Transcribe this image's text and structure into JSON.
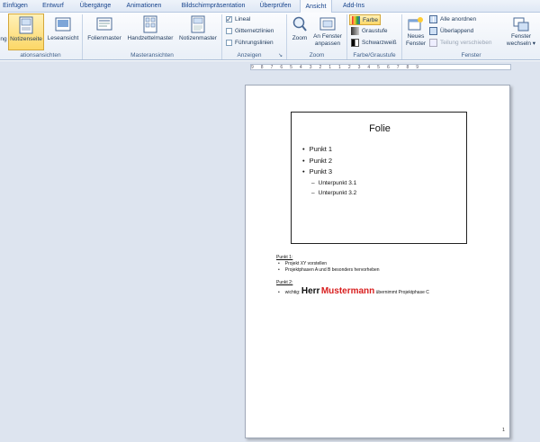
{
  "tabs": [
    "Einfügen",
    "Entwurf",
    "Übergänge",
    "Animationen",
    "Bildschirmpräsentation",
    "Überprüfen",
    "Ansicht",
    "Add-Ins"
  ],
  "ribbon": {
    "groups": {
      "presentation_views": "ationsansichten",
      "master_views": "Masteransichten",
      "show": "Anzeigen",
      "zoom": "Zoom",
      "color": "Farbe/Graustufe",
      "window": "Fenster"
    },
    "buttons": {
      "partial": "ng",
      "notes_page": "Notizenseite",
      "reading_view": "Leseansicht",
      "slide_master": "Folienmaster",
      "handout_master": "Handzettelmaster",
      "notes_master": "Notizenmaster",
      "zoom": "Zoom",
      "fit_window_1": "An Fenster",
      "fit_window_2": "anpassen",
      "new_window_1": "Neues",
      "new_window_2": "Fenster",
      "switch_window_1": "Fenster",
      "switch_window_2": "wechseln ▾"
    },
    "show": {
      "ruler": "Lineal",
      "gridlines": "Gitternetzlinien",
      "guides": "Führungslinien"
    },
    "color": {
      "color": "Farbe",
      "grayscale": "Graustufe",
      "bw": "Schwarzweiß"
    },
    "window": {
      "arrange_all": "Alle anordnen",
      "cascade": "Überlappend",
      "split": "Teilung verschieben"
    }
  },
  "ruler": [
    "9",
    "8",
    "7",
    "6",
    "5",
    "4",
    "3",
    "2",
    "1",
    "1",
    "2",
    "3",
    "4",
    "5",
    "6",
    "7",
    "8",
    "9"
  ],
  "slide": {
    "title": "Folie",
    "bullets": [
      "Punkt 1",
      "Punkt 2",
      "Punkt 3"
    ],
    "subbullets": [
      "Unterpunkt 3.1",
      "Unterpunkt 3.2"
    ]
  },
  "notes": {
    "head1": "Punkt 1:",
    "bullets1": [
      "Projekt XY vorstellen",
      "Projektphasen A und B besonders hervorheben"
    ],
    "head2": "Punkt 2:",
    "b2_pre": "wichtig:",
    "b2_big": "Herr",
    "b2_red": "Mustermann",
    "b2_post": "übernimmt Projektphase C"
  },
  "page_number": "1"
}
